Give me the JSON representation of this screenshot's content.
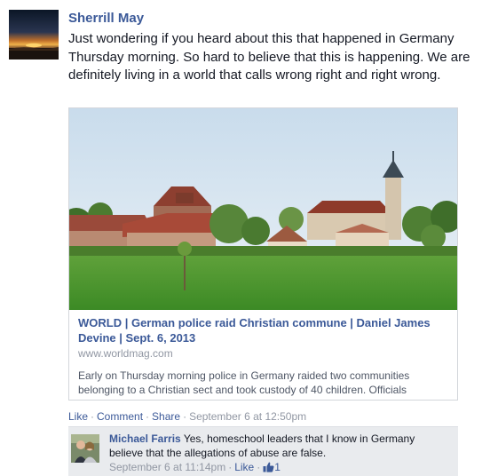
{
  "post": {
    "author": "Sherrill May",
    "text": "Just wondering if you heard about this that happened in Germany Thursday morning. So hard to believe that this is happening. We are definitely living in a world that calls wrong right and right wrong.",
    "shared_link": {
      "title": "WORLD | German police raid Christian commune | Daniel James Devine | Sept. 6, 2013",
      "domain": "www.worldmag.com",
      "description": "Early on Thursday morning police in Germany raided two communities belonging to a Christian sect and took custody of 40 children. Officials"
    },
    "actions": {
      "like": "Like",
      "comment": "Comment",
      "share": "Share",
      "timestamp": "September 6 at 12:50pm",
      "separator": "·"
    }
  },
  "comment": {
    "author": "Michael Farris",
    "text": "Yes, homeschool leaders that I know in Germany believe that the allegations of abuse are false.",
    "timestamp": "September 6 at 11:14pm",
    "like": "Like",
    "like_count": "1"
  },
  "colors": {
    "link": "#3b5998",
    "muted": "#9197a3",
    "comment_bg": "#e9ebee"
  }
}
